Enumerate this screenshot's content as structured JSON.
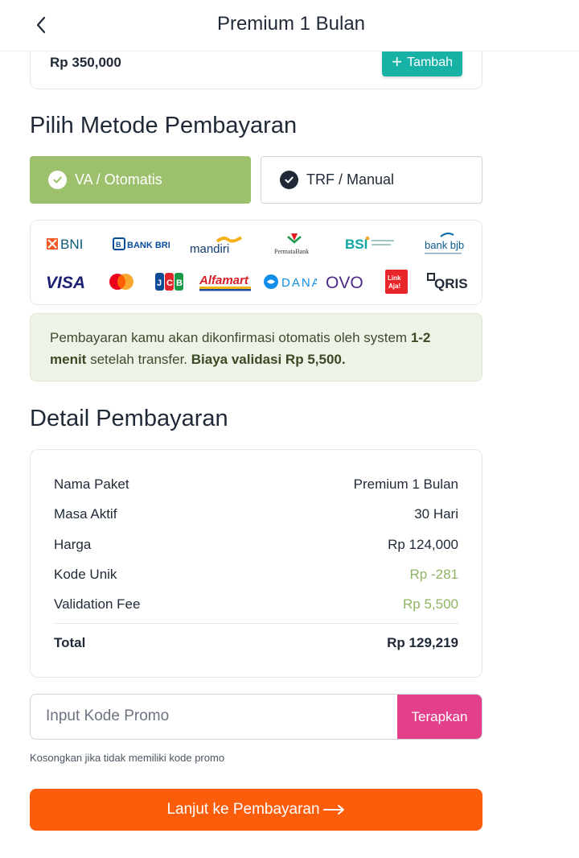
{
  "header": {
    "title": "Premium 1 Bulan",
    "back_icon": "chevron-left-icon"
  },
  "package": {
    "price": "Rp 350,000",
    "add_label": "Tambah"
  },
  "payment_method": {
    "title": "Pilih Metode Pembayaran",
    "options": [
      {
        "label": "VA / Otomatis",
        "selected": true
      },
      {
        "label": "TRF / Manual",
        "selected": false
      }
    ]
  },
  "banks": {
    "row1": [
      "BNI",
      "BANK BRI",
      "mandiri",
      "PermataBank",
      "BSI",
      "bank bjb"
    ],
    "row2": [
      "VISA",
      "mastercard",
      "JCB",
      "Alfamart",
      "DANA",
      "OVO",
      "LinkAja",
      "QRIS"
    ]
  },
  "info": {
    "text_1": "Pembayaran kamu akan dikonfirmasi otomatis oleh system ",
    "bold_1": "1-2 menit",
    "text_2": " setelah transfer. ",
    "bold_2": "Biaya validasi Rp 5,500."
  },
  "detail": {
    "title": "Detail Pembayaran",
    "rows": [
      {
        "label": "Nama Paket",
        "value": "Premium 1 Bulan"
      },
      {
        "label": "Masa Aktif",
        "value": "30 Hari"
      },
      {
        "label": "Harga",
        "value": "Rp 124,000"
      },
      {
        "label": "Kode Unik",
        "value": "Rp -281"
      },
      {
        "label": "Validation Fee",
        "value": "Rp 5,500"
      }
    ],
    "total_label": "Total",
    "total_value": "Rp 129,219"
  },
  "promo": {
    "placeholder": "Input Kode Promo",
    "value": "",
    "apply_label": "Terapkan",
    "hint": "Kosongkan jika tidak memiliki kode promo"
  },
  "cta": {
    "label": "Lanjut ke Pembayaran"
  },
  "colors": {
    "selected_method": "#9dc06d",
    "add_button": "#17b1a5",
    "apply_button": "#e2408b",
    "cta": "#fb5d0a",
    "positive_adjust": "#8fb463"
  }
}
